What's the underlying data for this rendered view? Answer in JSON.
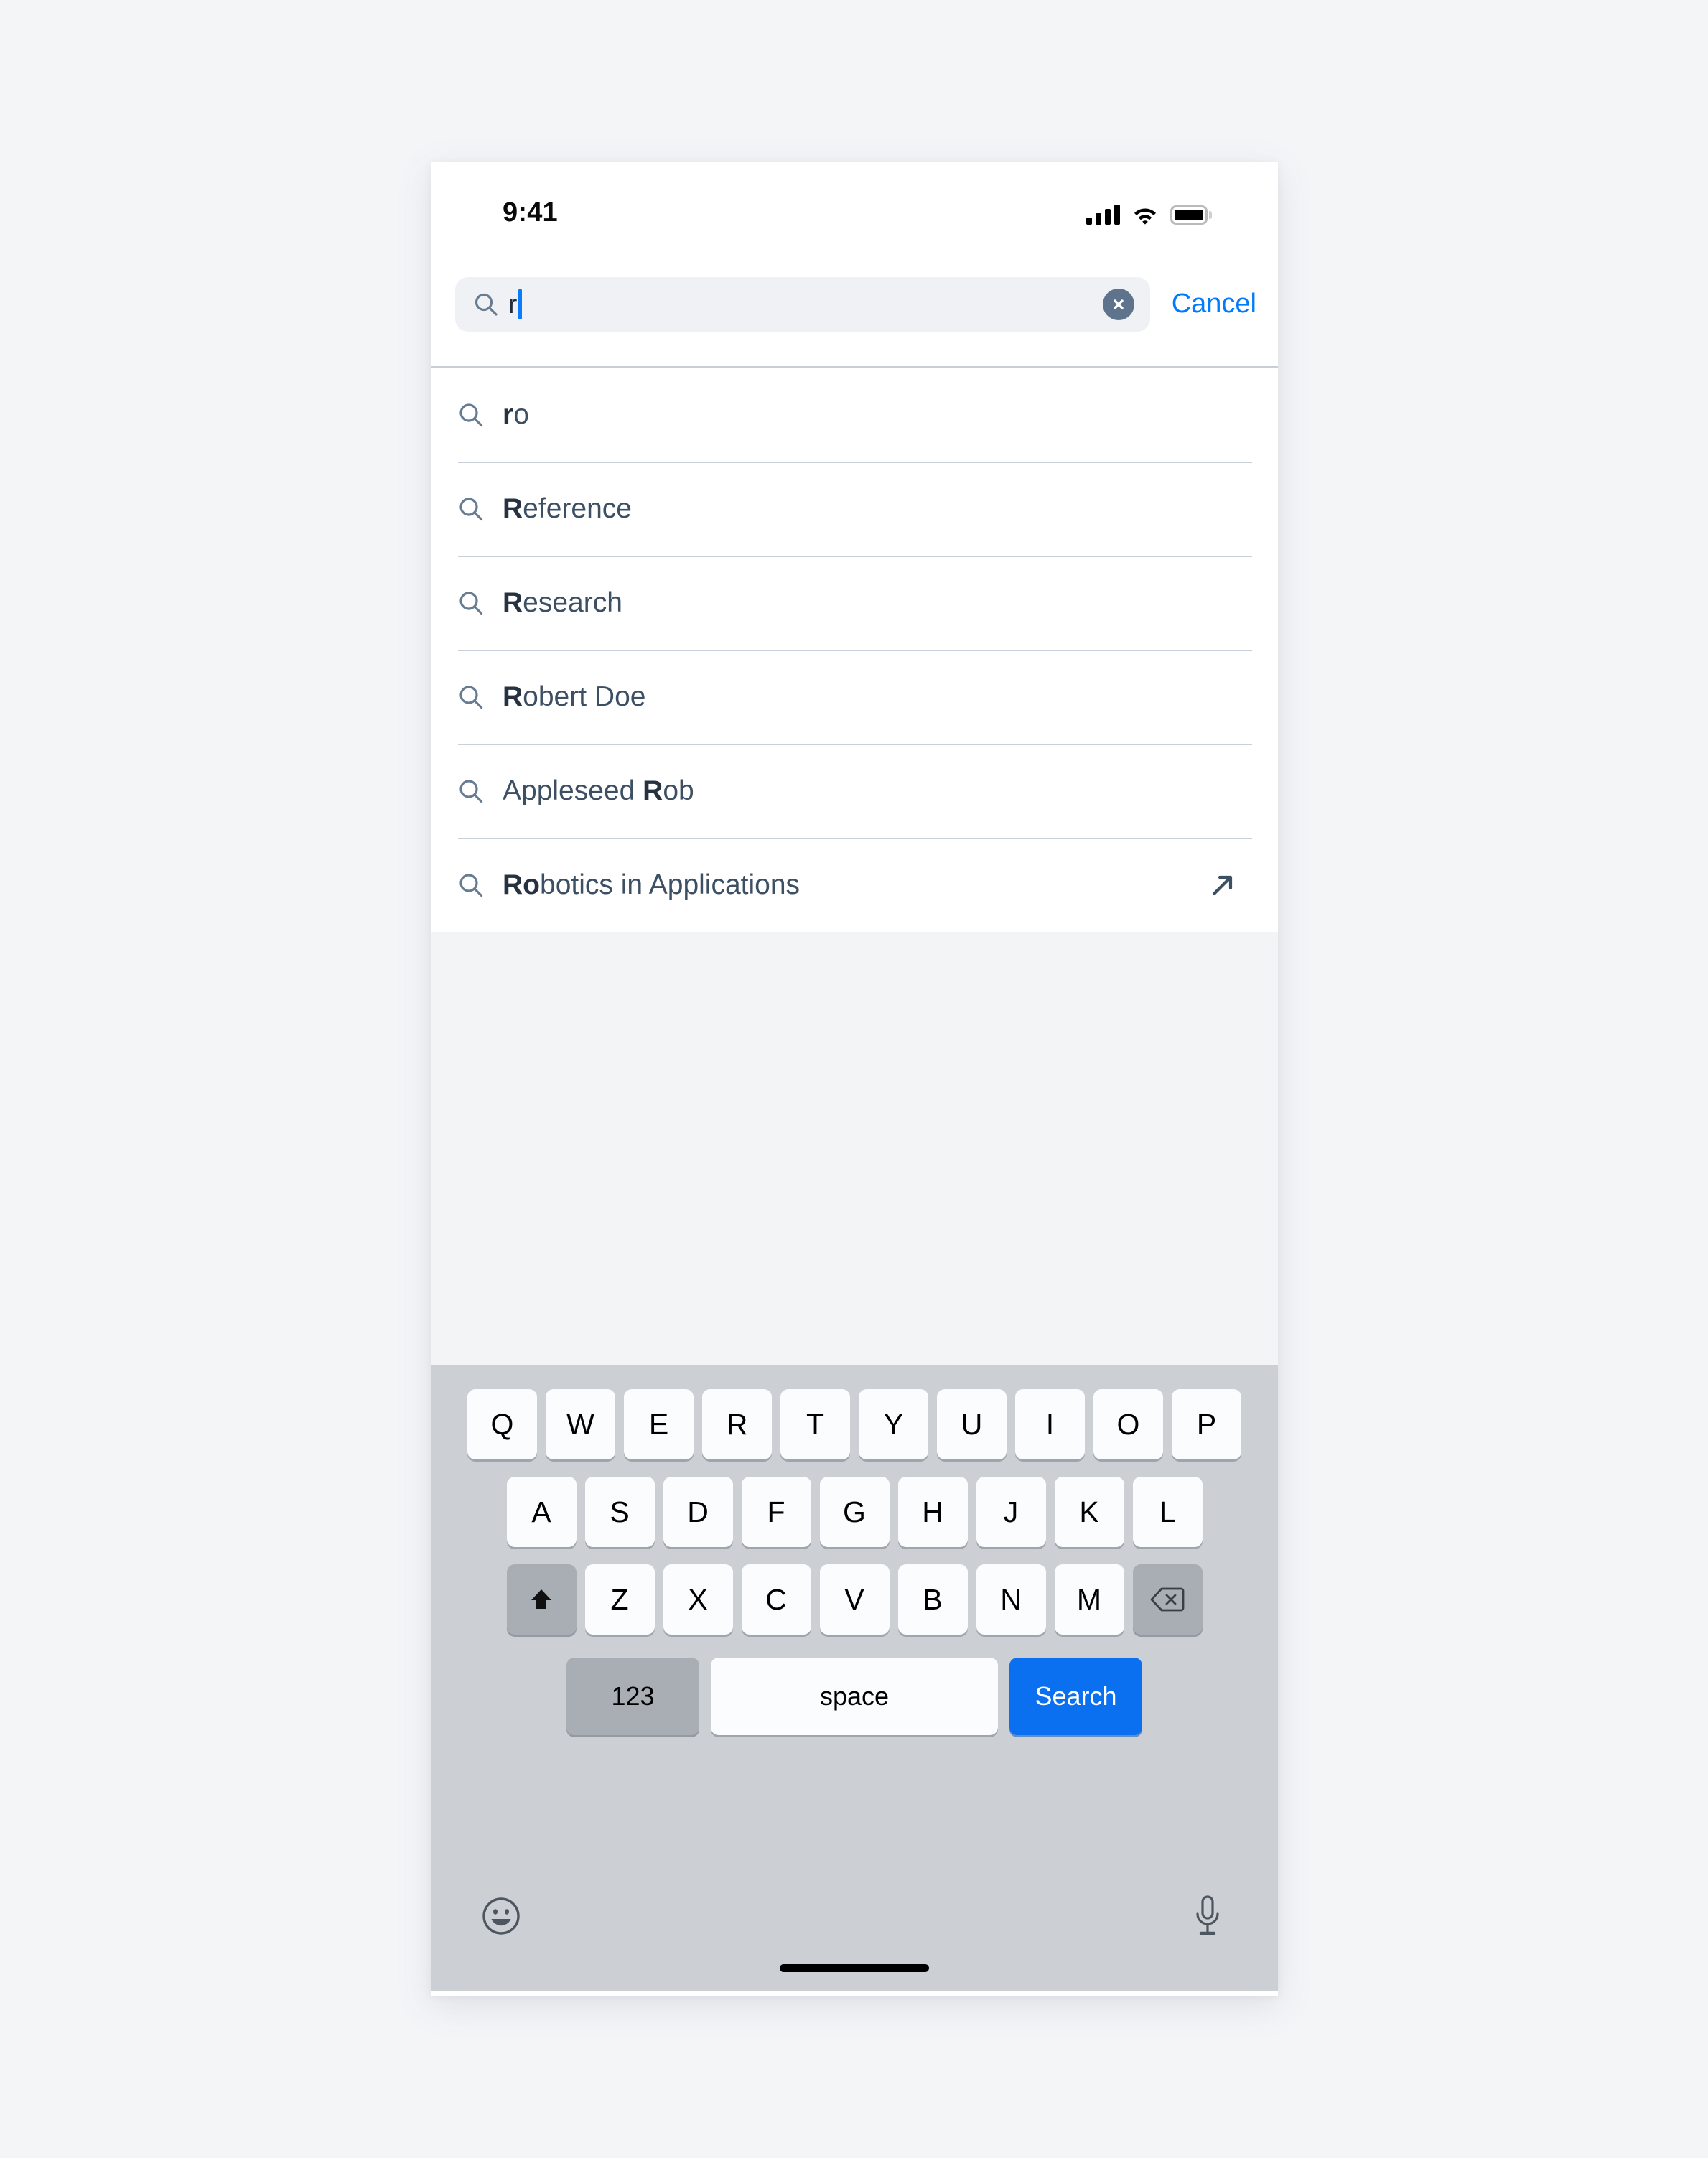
{
  "status_bar": {
    "time": "9:41",
    "icons": [
      "cellular-signal-icon",
      "wifi-icon",
      "battery-icon"
    ]
  },
  "search": {
    "value": "r",
    "placeholder": "Search",
    "search_icon": "search-icon",
    "clear_label": "✕",
    "cancel_label": "Cancel",
    "accent_color": "#007aff",
    "clear_button_color": "#5e748c",
    "field_background": "#eff1f4",
    "caret_color": "#0a7cff"
  },
  "suggestions": {
    "rows": [
      {
        "icon": "search-icon",
        "match": "r",
        "rest": "o",
        "trailing_icon": null
      },
      {
        "icon": "search-icon",
        "match": "R",
        "rest": "eference",
        "trailing_icon": null
      },
      {
        "icon": "search-icon",
        "match": "R",
        "rest": "esearch",
        "trailing_icon": null
      },
      {
        "icon": "search-icon",
        "match": "R",
        "rest": "obert Doe",
        "trailing_icon": null
      },
      {
        "icon": "search-icon",
        "prefix": "Appleseed ",
        "match": "R",
        "rest": "ob",
        "trailing_icon": null
      },
      {
        "icon": "search-icon",
        "match": "Ro",
        "rest": "botics in Applications",
        "trailing_icon": "arrow-up-right-icon"
      }
    ],
    "text_color": "#3d4f63",
    "match_color": "#26323f",
    "divider_color": "#c9d0da"
  },
  "content_area": {
    "background": "#f2f4f6"
  },
  "keyboard": {
    "background": "#ccd0d5",
    "row1": [
      "Q",
      "W",
      "E",
      "R",
      "T",
      "Y",
      "U",
      "I",
      "O",
      "P"
    ],
    "row2": [
      "A",
      "S",
      "D",
      "F",
      "G",
      "H",
      "J",
      "K",
      "L"
    ],
    "row3_letters": [
      "Z",
      "X",
      "C",
      "V",
      "B",
      "N",
      "M"
    ],
    "shift_icon": "shift-icon",
    "backspace_icon": "backspace-icon",
    "numeric_label": "123",
    "space_label": "space",
    "action_label": "Search",
    "action_color": "#0a70f0",
    "emoji_icon": "emoji-icon",
    "mic_icon": "microphone-icon",
    "home_indicator": "home-indicator"
  }
}
